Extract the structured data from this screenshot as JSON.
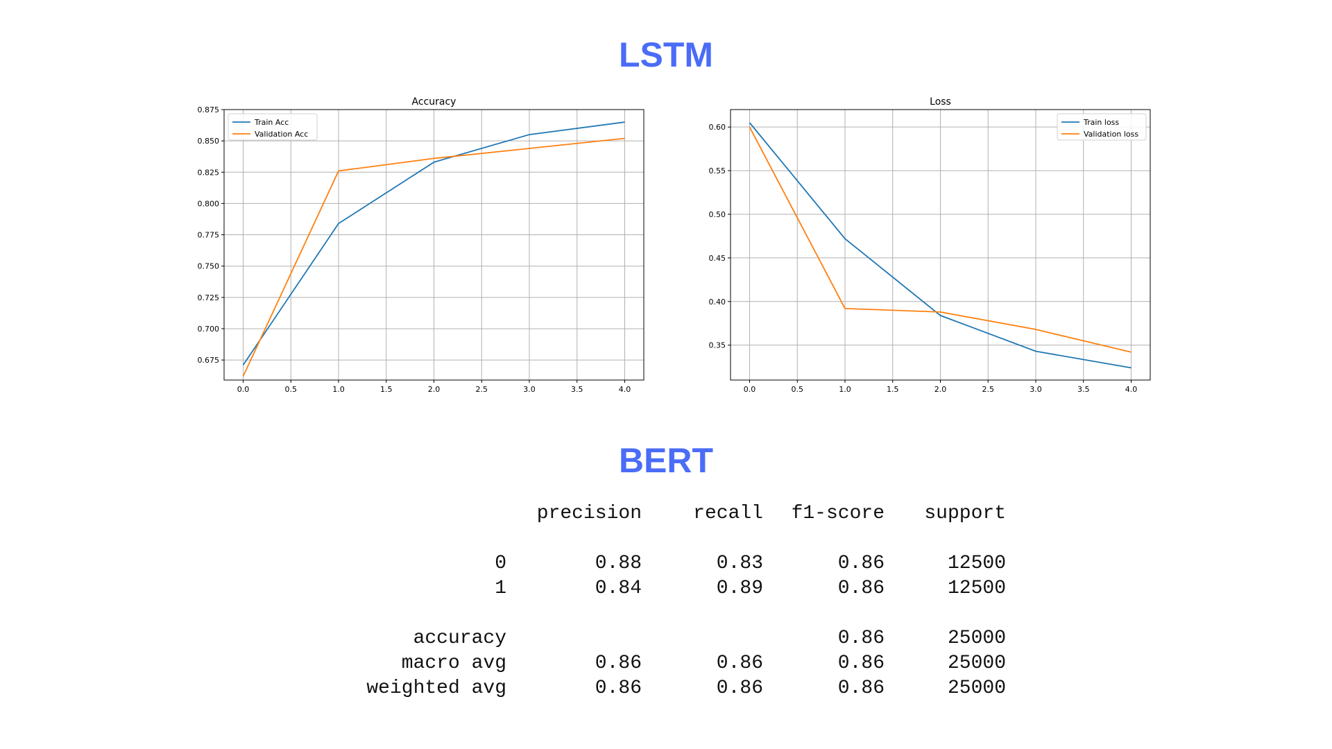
{
  "headings": {
    "lstm": "LSTM",
    "bert": "BERT"
  },
  "colors": {
    "heading": "#4a6cf7",
    "train": "#1f77b4",
    "validation": "#ff7f0e",
    "grid": "#b0b0b0",
    "axis": "#000000"
  },
  "chart_data": [
    {
      "type": "line",
      "title": "Accuracy",
      "xlabel": "",
      "ylabel": "",
      "x": [
        0,
        1,
        2,
        3,
        4
      ],
      "xlim": [
        -0.2,
        4.2
      ],
      "ylim": [
        0.659,
        0.875
      ],
      "xticks": [
        "0.0",
        "0.5",
        "1.0",
        "1.5",
        "2.0",
        "2.5",
        "3.0",
        "3.5",
        "4.0"
      ],
      "yticks": [
        "0.675",
        "0.700",
        "0.725",
        "0.750",
        "0.775",
        "0.800",
        "0.825",
        "0.850",
        "0.875"
      ],
      "grid": true,
      "legend_position": "upper left",
      "series": [
        {
          "name": "Train Acc",
          "values": [
            0.671,
            0.784,
            0.833,
            0.855,
            0.865
          ]
        },
        {
          "name": "Validation Acc",
          "values": [
            0.662,
            0.826,
            0.836,
            0.844,
            0.852
          ]
        }
      ]
    },
    {
      "type": "line",
      "title": "Loss",
      "xlabel": "",
      "ylabel": "",
      "x": [
        0,
        1,
        2,
        3,
        4
      ],
      "xlim": [
        -0.2,
        4.2
      ],
      "ylim": [
        0.31,
        0.62
      ],
      "xticks": [
        "0.0",
        "0.5",
        "1.0",
        "1.5",
        "2.0",
        "2.5",
        "3.0",
        "3.5",
        "4.0"
      ],
      "yticks": [
        "0.35",
        "0.40",
        "0.45",
        "0.50",
        "0.55",
        "0.60"
      ],
      "grid": true,
      "legend_position": "upper right",
      "series": [
        {
          "name": "Train loss",
          "values": [
            0.605,
            0.472,
            0.384,
            0.343,
            0.324
          ]
        },
        {
          "name": "Validation loss",
          "values": [
            0.6,
            0.392,
            0.388,
            0.368,
            0.342
          ]
        }
      ]
    }
  ],
  "report": {
    "headers": [
      "precision",
      "recall",
      "f1-score",
      "support"
    ],
    "rows": [
      {
        "label": "0",
        "values": [
          "0.88",
          "0.83",
          "0.86",
          "12500"
        ]
      },
      {
        "label": "1",
        "values": [
          "0.84",
          "0.89",
          "0.86",
          "12500"
        ]
      },
      {
        "label": "accuracy",
        "values": [
          "",
          "",
          "0.86",
          "25000"
        ]
      },
      {
        "label": "macro avg",
        "values": [
          "0.86",
          "0.86",
          "0.86",
          "25000"
        ]
      },
      {
        "label": "weighted avg",
        "values": [
          "0.86",
          "0.86",
          "0.86",
          "25000"
        ]
      }
    ]
  }
}
